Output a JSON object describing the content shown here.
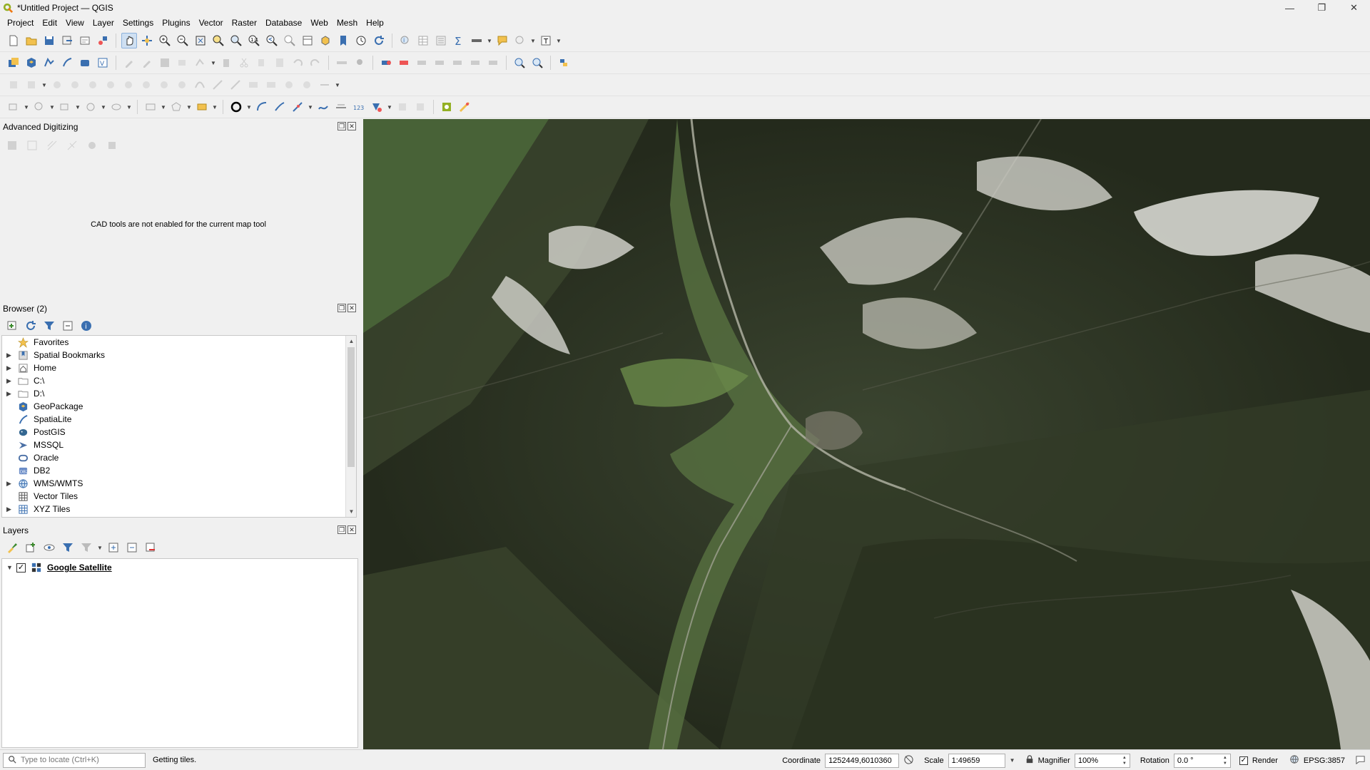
{
  "window": {
    "title": "*Untitled Project — QGIS",
    "controls": [
      "minimize",
      "maximize",
      "close"
    ]
  },
  "menubar": {
    "items": [
      "Project",
      "Edit",
      "View",
      "Layer",
      "Settings",
      "Plugins",
      "Vector",
      "Raster",
      "Database",
      "Web",
      "Mesh",
      "Help"
    ]
  },
  "panels": {
    "advanced_digitizing": {
      "title": "Advanced Digitizing",
      "message": "CAD tools are not enabled for the current map tool"
    },
    "browser": {
      "title": "Browser (2)",
      "items": [
        {
          "label": "Favorites",
          "icon": "star-icon",
          "expandable": false
        },
        {
          "label": "Spatial Bookmarks",
          "icon": "bookmark-icon",
          "expandable": true
        },
        {
          "label": "Home",
          "icon": "home-folder-icon",
          "expandable": true
        },
        {
          "label": "C:\\",
          "icon": "folder-icon",
          "expandable": true
        },
        {
          "label": "D:\\",
          "icon": "folder-icon",
          "expandable": true
        },
        {
          "label": "GeoPackage",
          "icon": "geopackage-icon",
          "expandable": false
        },
        {
          "label": "SpatiaLite",
          "icon": "spatialite-icon",
          "expandable": false
        },
        {
          "label": "PostGIS",
          "icon": "postgis-icon",
          "expandable": false
        },
        {
          "label": "MSSQL",
          "icon": "mssql-icon",
          "expandable": false
        },
        {
          "label": "Oracle",
          "icon": "oracle-icon",
          "expandable": false
        },
        {
          "label": "DB2",
          "icon": "db2-icon",
          "expandable": false
        },
        {
          "label": "WMS/WMTS",
          "icon": "globe-icon",
          "expandable": true
        },
        {
          "label": "Vector Tiles",
          "icon": "vector-tiles-icon",
          "expandable": false
        },
        {
          "label": "XYZ Tiles",
          "icon": "xyz-tiles-icon",
          "expandable": true
        }
      ]
    },
    "layers": {
      "title": "Layers",
      "items": [
        {
          "label": "Google Satellite",
          "checked": true,
          "expanded": true
        }
      ]
    }
  },
  "statusbar": {
    "locator_placeholder": "Type to locate (Ctrl+K)",
    "message": "Getting tiles.",
    "coordinate_label": "Coordinate",
    "coordinate_value": "1252449,6010360",
    "scale_label": "Scale",
    "scale_value": "1:49659",
    "magnifier_label": "Magnifier",
    "magnifier_value": "100%",
    "rotation_label": "Rotation",
    "rotation_value": "0.0 °",
    "render_label": "Render",
    "render_checked": true,
    "crs": "EPSG:3857"
  },
  "colors": {
    "chrome": "#f0f0f0",
    "map_dark_forest": "#2c3322",
    "map_valley_green": "#5c7a45",
    "map_rock": "#cfcfc8",
    "accent_blue": "#3a6fb0"
  }
}
